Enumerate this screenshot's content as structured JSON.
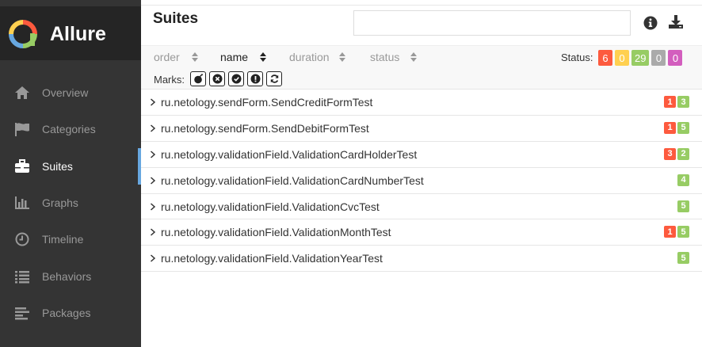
{
  "app": {
    "name": "Allure"
  },
  "sidebar": {
    "items": [
      {
        "label": "Overview",
        "icon": "home-icon",
        "active": false
      },
      {
        "label": "Categories",
        "icon": "flag-icon",
        "active": false
      },
      {
        "label": "Suites",
        "icon": "briefcase-icon",
        "active": true
      },
      {
        "label": "Graphs",
        "icon": "bar-chart-icon",
        "active": false
      },
      {
        "label": "Timeline",
        "icon": "clock-icon",
        "active": false
      },
      {
        "label": "Behaviors",
        "icon": "list-icon",
        "active": false
      },
      {
        "label": "Packages",
        "icon": "align-left-icon",
        "active": false
      }
    ]
  },
  "header": {
    "title": "Suites",
    "search_value": "",
    "search_placeholder": ""
  },
  "toolbar": {
    "sort": [
      {
        "label": "order",
        "active": false
      },
      {
        "label": "name",
        "active": true
      },
      {
        "label": "duration",
        "active": false
      },
      {
        "label": "status",
        "active": false
      }
    ],
    "status_label": "Status:",
    "status_badges": [
      {
        "value": "6",
        "color": "#fd5a3e",
        "status": "failed"
      },
      {
        "value": "0",
        "color": "#ffd050",
        "status": "broken"
      },
      {
        "value": "29",
        "color": "#97cc64",
        "status": "passed"
      },
      {
        "value": "0",
        "color": "#aaaaaa",
        "status": "skipped"
      },
      {
        "value": "0",
        "color": "#d35ebe",
        "status": "unknown"
      }
    ],
    "marks_label": "Marks:",
    "marks": [
      "bomb-icon",
      "times-circle-icon",
      "check-circle-icon",
      "exclamation-circle-icon",
      "refresh-icon"
    ]
  },
  "colors": {
    "failed": "#fd5a3e",
    "passed": "#97cc64",
    "accent": "#67a7e0"
  },
  "suites": [
    {
      "name": "ru.netology.sendForm.SendCreditFormTest",
      "counts": [
        {
          "value": "1",
          "status": "failed"
        },
        {
          "value": "3",
          "status": "passed"
        }
      ]
    },
    {
      "name": "ru.netology.sendForm.SendDebitFormTest",
      "counts": [
        {
          "value": "1",
          "status": "failed"
        },
        {
          "value": "5",
          "status": "passed"
        }
      ]
    },
    {
      "name": "ru.netology.validationField.ValidationCardHolderTest",
      "counts": [
        {
          "value": "3",
          "status": "failed"
        },
        {
          "value": "2",
          "status": "passed"
        }
      ]
    },
    {
      "name": "ru.netology.validationField.ValidationCardNumberTest",
      "counts": [
        {
          "value": "4",
          "status": "passed"
        }
      ]
    },
    {
      "name": "ru.netology.validationField.ValidationCvcTest",
      "counts": [
        {
          "value": "5",
          "status": "passed"
        }
      ]
    },
    {
      "name": "ru.netology.validationField.ValidationMonthTest",
      "counts": [
        {
          "value": "1",
          "status": "failed"
        },
        {
          "value": "5",
          "status": "passed"
        }
      ]
    },
    {
      "name": "ru.netology.validationField.ValidationYearTest",
      "counts": [
        {
          "value": "5",
          "status": "passed"
        }
      ]
    }
  ]
}
